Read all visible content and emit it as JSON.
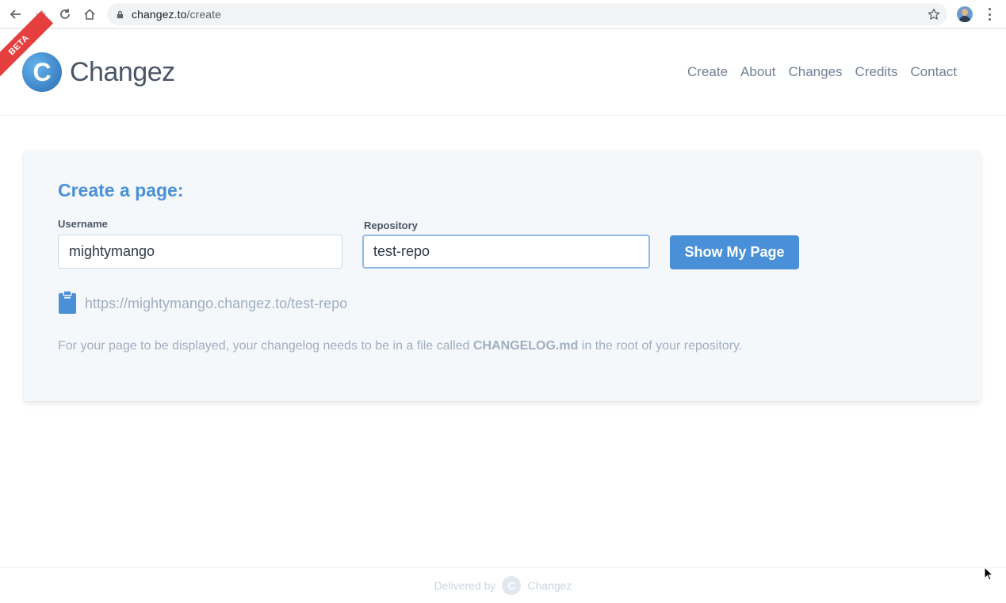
{
  "browser": {
    "url_domain": "changez.to",
    "url_path": "/create"
  },
  "header": {
    "beta_label": "BETA",
    "logo_text": "Changez",
    "logo_letter": "C",
    "nav": [
      "Create",
      "About",
      "Changes",
      "Credits",
      "Contact"
    ]
  },
  "form": {
    "title": "Create a page:",
    "username_label": "Username",
    "username_value": "mightymango",
    "repository_label": "Repository",
    "repository_value": "test-repo",
    "submit_label": "Show My Page",
    "page_url": "https://mightymango.changez.to/test-repo",
    "help_prefix": "For your page to be displayed, your changelog needs to be in a file called ",
    "help_filename": "CHANGELOG.md",
    "help_suffix": " in the root of your repository."
  },
  "footer": {
    "delivered_by": "Delivered by",
    "brand": "Changez",
    "logo_letter": "C"
  },
  "colors": {
    "accent": "#4a90d9",
    "ribbon": "#e53e3e",
    "card_bg": "#f5f8fb"
  }
}
